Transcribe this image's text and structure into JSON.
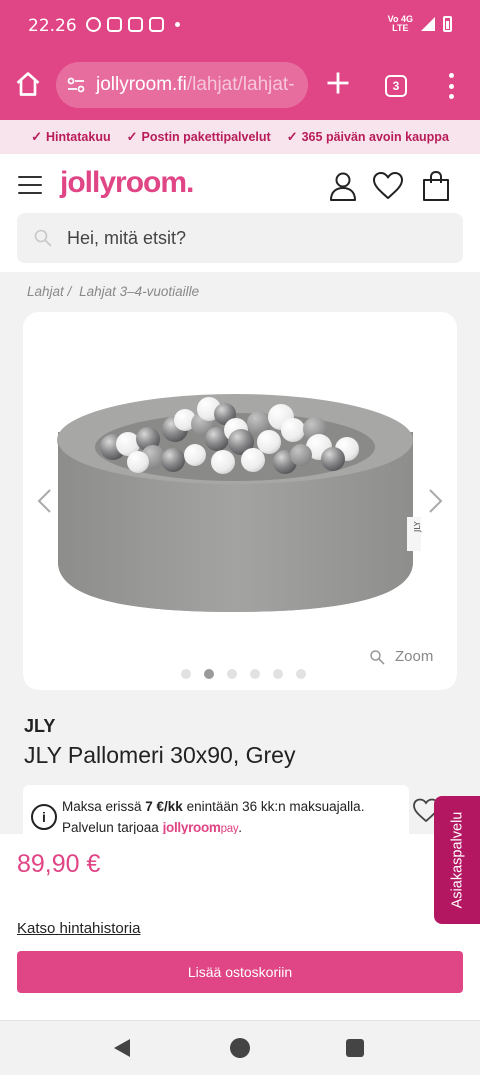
{
  "status_bar": {
    "time": "22.26",
    "network_top": "Vo 4G",
    "network_bottom": "LTE"
  },
  "browser": {
    "url_domain": "jollyroom.fi",
    "url_path": "/lahjat/lahjat-",
    "tab_count": "3"
  },
  "usp": [
    {
      "label": "Hintatakuu"
    },
    {
      "label": "Postin pakettipalvelut"
    },
    {
      "label": "365 päivän avoin kauppa"
    }
  ],
  "header": {
    "logo": "jollyroom.",
    "search_placeholder": "Hei, mitä etsit?"
  },
  "breadcrumb": {
    "items": [
      "Lahjat /",
      "Lahjat 3–4-vuotiaille"
    ]
  },
  "gallery": {
    "zoom_label": "Zoom",
    "dot_count": 6,
    "active_index": 1
  },
  "product": {
    "brand": "JLY",
    "title": "JLY Pallomeri 30x90, Grey",
    "pay_prefix": "Maksa erissä ",
    "pay_amount": "7 €/kk",
    "pay_suffix": " enintään 36 kk:n maksuajalla.",
    "pay_line2": "Palvelun tarjoaa ",
    "pay_logo_main": "jollyroom",
    "pay_logo_sub": "pay",
    "pay_line2_end": ".",
    "price": "89,90 €",
    "history_link": "Katso hintahistoria",
    "add_to_cart": "Lisää ostoskoriin"
  },
  "side_tab": {
    "label": "Asiakaspalvelu"
  },
  "colors": {
    "brand_pink": "#e04585",
    "side_tab": "#b41762",
    "usp_text": "#b81c5a"
  },
  "icons": [
    "home-icon",
    "tune-icon",
    "plus-icon",
    "tabs-icon",
    "more-icon",
    "menu-icon",
    "account-icon",
    "heart-icon",
    "bag-icon",
    "search-icon",
    "chevron-left-icon",
    "chevron-right-icon",
    "zoom-icon",
    "info-icon"
  ]
}
